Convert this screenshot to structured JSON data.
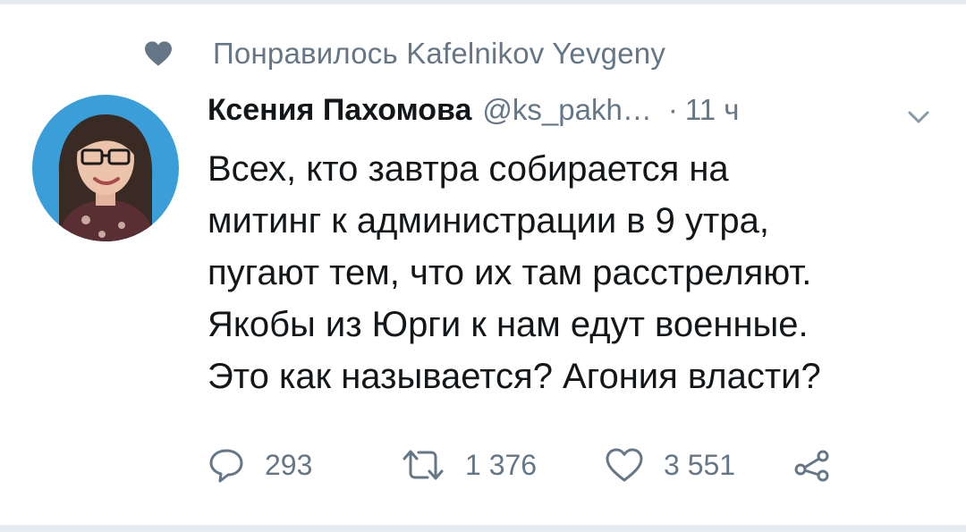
{
  "social_context": {
    "icon": "heart-icon",
    "text": "Понравилось Kafelnikov Yevgeny"
  },
  "tweet": {
    "author": {
      "display_name": "Ксения Пахомова",
      "handle": "@ks_pakh…"
    },
    "separator": "·",
    "time": "11 ч",
    "text_lines": [
      "Всех, кто завтра собирается на",
      "митинг к администрации в 9 утра,",
      "пугают тем, что их там расстреляют.",
      "Якобы из Юрги к нам едут военные.",
      "Это как называется? Агония власти?"
    ],
    "actions": {
      "reply": {
        "icon": "reply-icon",
        "count": "293"
      },
      "retweet": {
        "icon": "retweet-icon",
        "count": "1 376"
      },
      "like": {
        "icon": "like-icon",
        "count": "3 551"
      },
      "share": {
        "icon": "share-icon"
      }
    }
  },
  "colors": {
    "text_primary": "#14171a",
    "text_secondary": "#657786",
    "divider": "#e6ecf0",
    "avatar_background": "#3a9fd8"
  }
}
